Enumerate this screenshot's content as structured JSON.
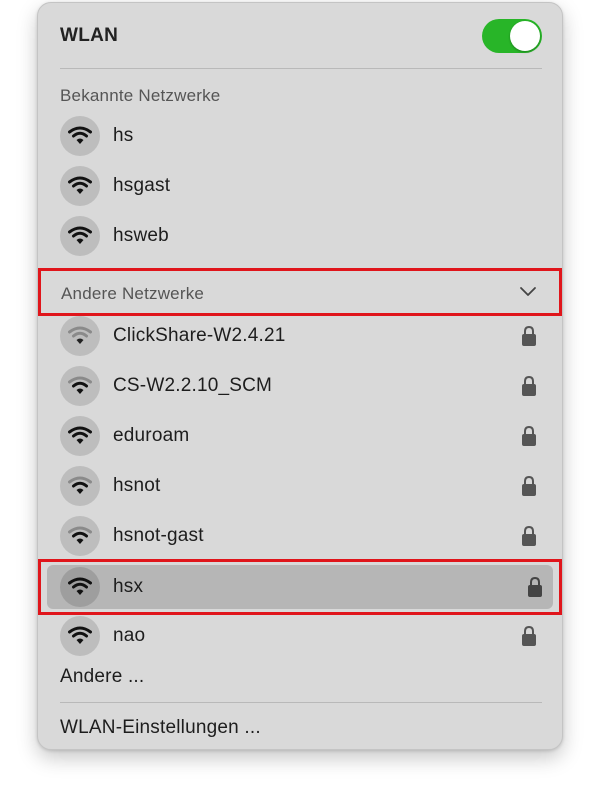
{
  "header": {
    "title": "WLAN",
    "toggle_on": true,
    "toggle_color": "#28b528"
  },
  "known_section": {
    "label": "Bekannte Netzwerke",
    "networks": [
      {
        "name": "hs",
        "locked": false,
        "signal": "strong"
      },
      {
        "name": "hsgast",
        "locked": false,
        "signal": "strong"
      },
      {
        "name": "hsweb",
        "locked": false,
        "signal": "strong"
      }
    ]
  },
  "other_section": {
    "label": "Andere Netzwerke",
    "expanded": true,
    "networks": [
      {
        "name": "ClickShare-W2.4.21",
        "locked": true,
        "signal": "weak"
      },
      {
        "name": "CS-W2.2.10_SCM",
        "locked": true,
        "signal": "medium"
      },
      {
        "name": "eduroam",
        "locked": true,
        "signal": "strong"
      },
      {
        "name": "hsnot",
        "locked": true,
        "signal": "medium"
      },
      {
        "name": "hsnot-gast",
        "locked": true,
        "signal": "medium"
      },
      {
        "name": "hsx",
        "locked": true,
        "signal": "strong",
        "selected": true
      },
      {
        "name": "nao",
        "locked": true,
        "signal": "strong"
      }
    ]
  },
  "footer": {
    "other_label": "Andere ...",
    "settings_label": "WLAN-Einstellungen ..."
  },
  "colors": {
    "highlight": "#e0151b",
    "panel": "#d9d9d9"
  }
}
